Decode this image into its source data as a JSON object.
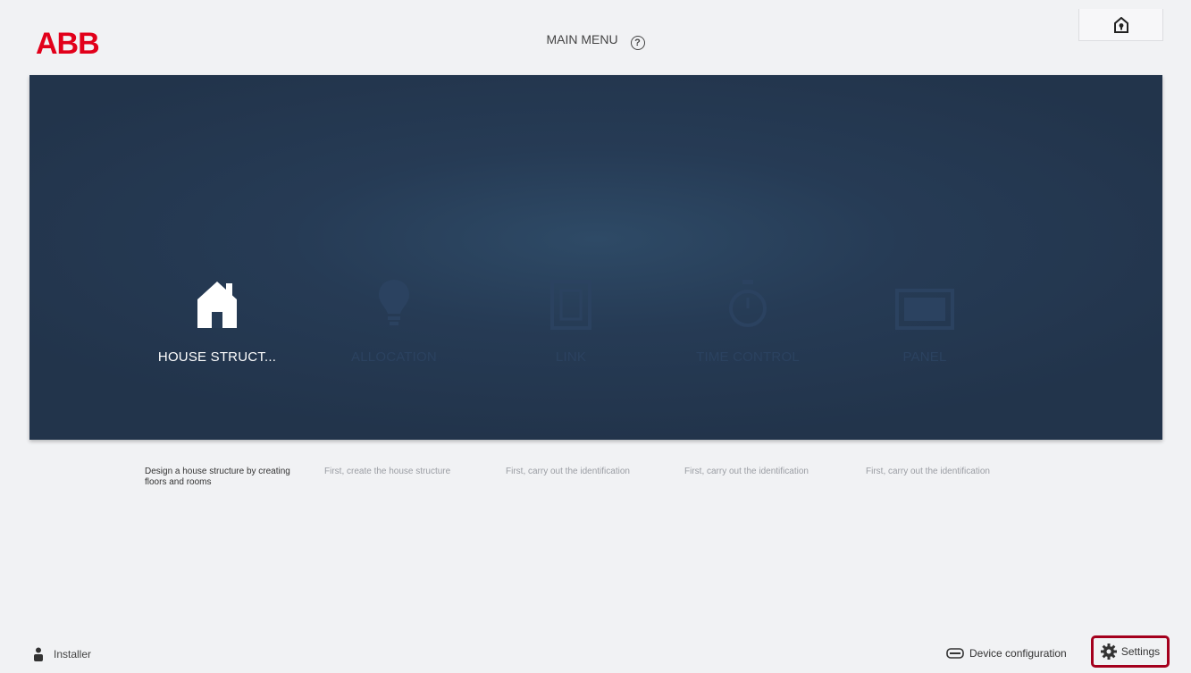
{
  "header": {
    "logo_text": "ABB",
    "title": "MAIN MENU",
    "help_glyph": "?",
    "home_icon": "home-shield-icon"
  },
  "tiles": [
    {
      "label": "HOUSE STRUCT...",
      "icon": "house-icon",
      "state": "active",
      "description": "Design a house structure by creating floors and rooms"
    },
    {
      "label": "ALLOCATION",
      "icon": "lightbulb-icon",
      "state": "disabled",
      "description": "First, create the house structure"
    },
    {
      "label": "LINK",
      "icon": "link-panel-icon",
      "state": "disabled",
      "description": "First, carry out the identification"
    },
    {
      "label": "TIME CONTROL",
      "icon": "stopwatch-icon",
      "state": "disabled",
      "description": "First, carry out the identification"
    },
    {
      "label": "PANEL",
      "icon": "panel-icon",
      "state": "disabled",
      "description": "First, carry out the identification"
    }
  ],
  "footer": {
    "user_label": "Installer",
    "device_config_label": "Device configuration",
    "settings_label": "Settings"
  },
  "colors": {
    "brand": "#e2001a",
    "stage": "#263b55",
    "highlight": "#a4001d"
  }
}
